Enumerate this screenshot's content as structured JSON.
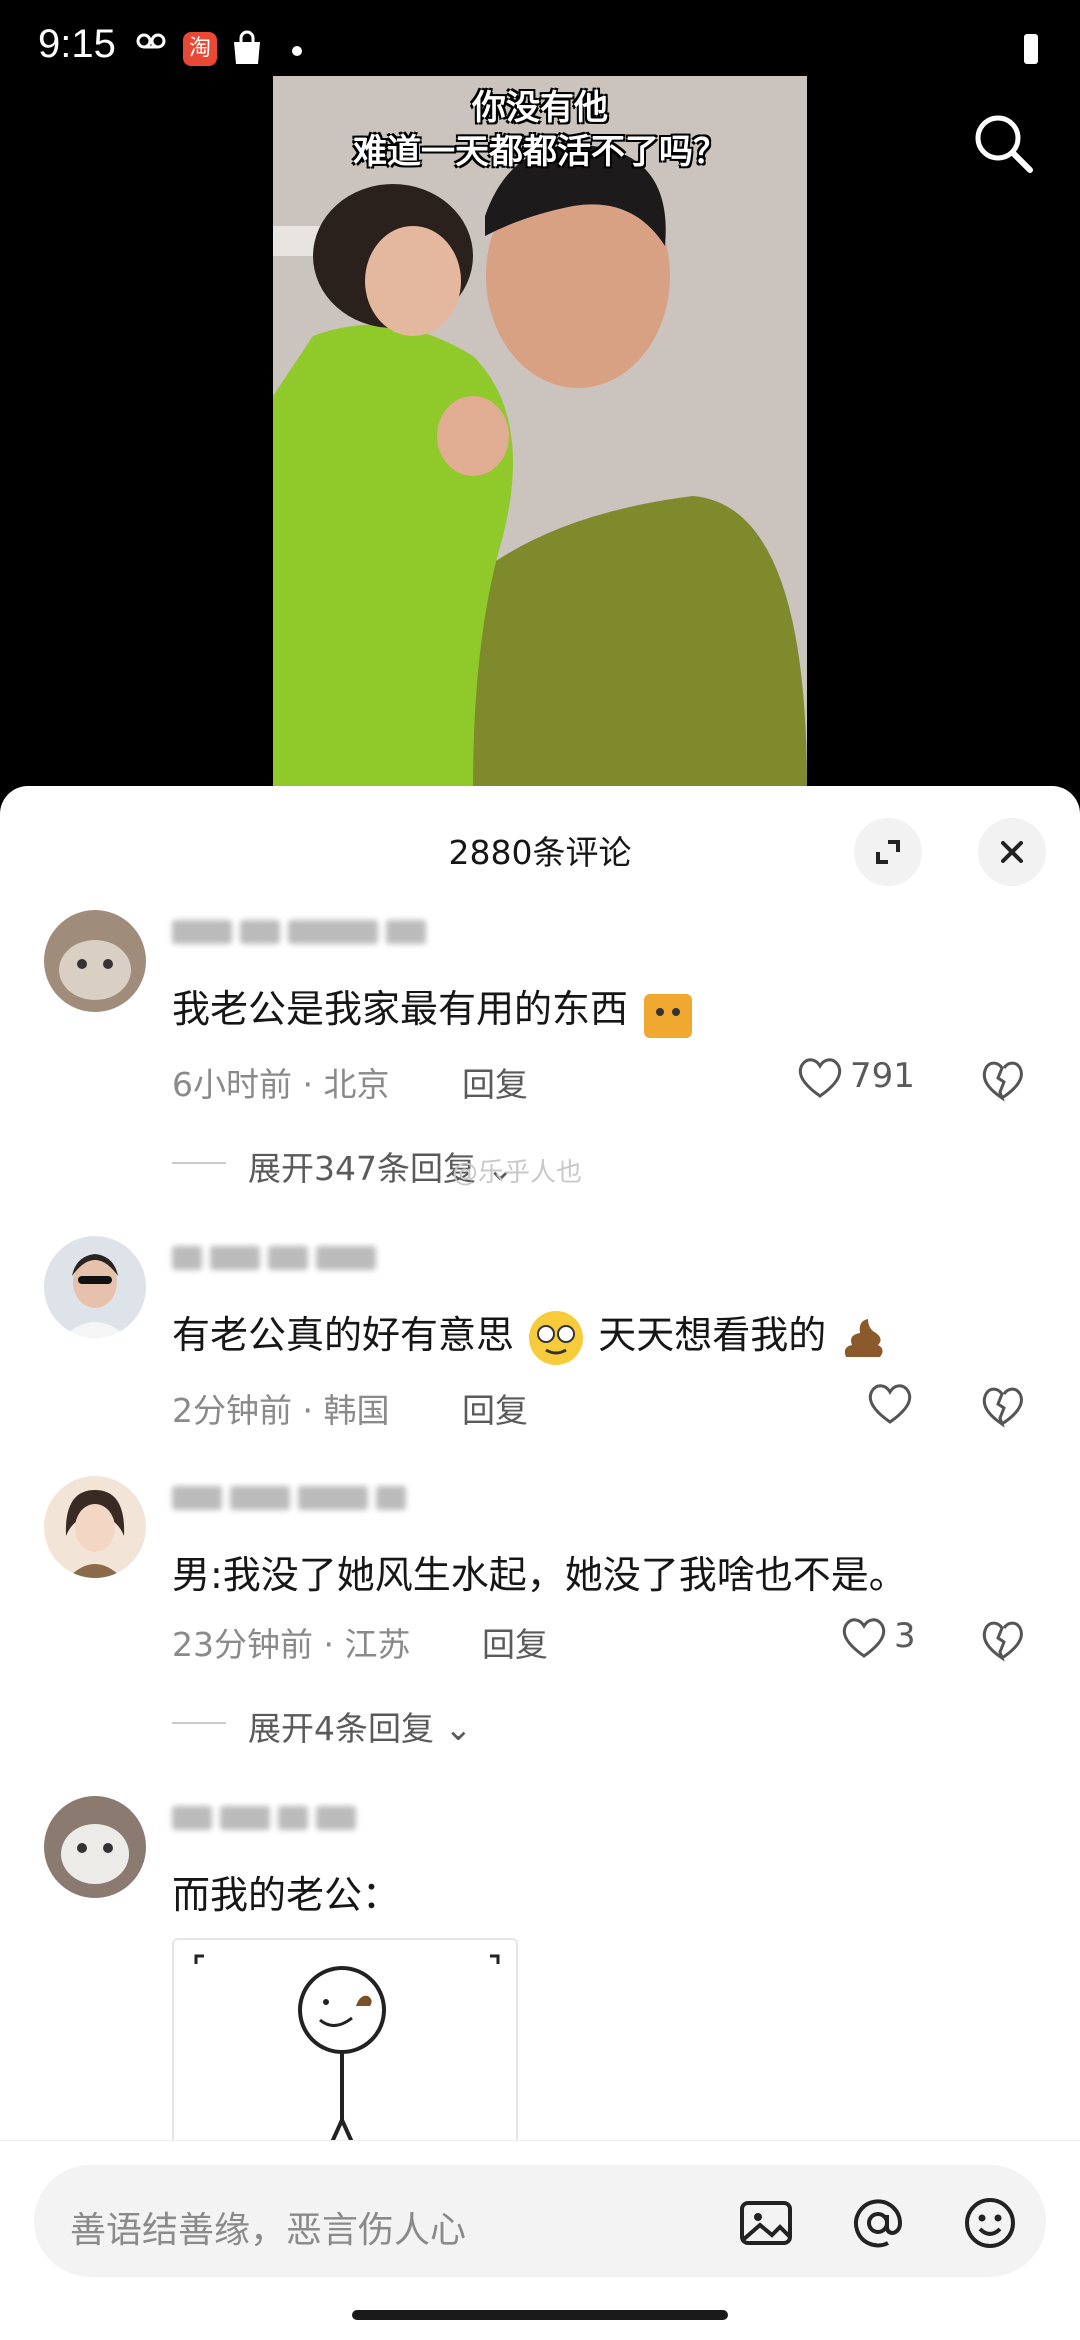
{
  "status_bar": {
    "time": "9:15"
  },
  "video": {
    "caption_line1": "你没有他",
    "caption_line2": "难道一天都都活不了吗？"
  },
  "sheet": {
    "title": "2880条评论"
  },
  "comments": [
    {
      "text": "我老公是我家最有用的东西",
      "time": "6小时前 · 北京",
      "reply": "回复",
      "likes": "791",
      "expand": "展开347条回复"
    },
    {
      "text_a": "有老公真的好有意思",
      "text_b": " 天天想看我的",
      "time": "2分钟前 · 韩国",
      "reply": "回复",
      "likes": ""
    },
    {
      "text": "男:我没了她风生水起，她没了我啥也不是。",
      "time": "23分钟前 · 江苏",
      "reply": "回复",
      "likes": "3",
      "expand": "展开4条回复"
    },
    {
      "text": "而我的老公："
    }
  ],
  "watermark": "@乐乎人也",
  "input": {
    "placeholder": "善语结善缘，恶言伤人心"
  }
}
